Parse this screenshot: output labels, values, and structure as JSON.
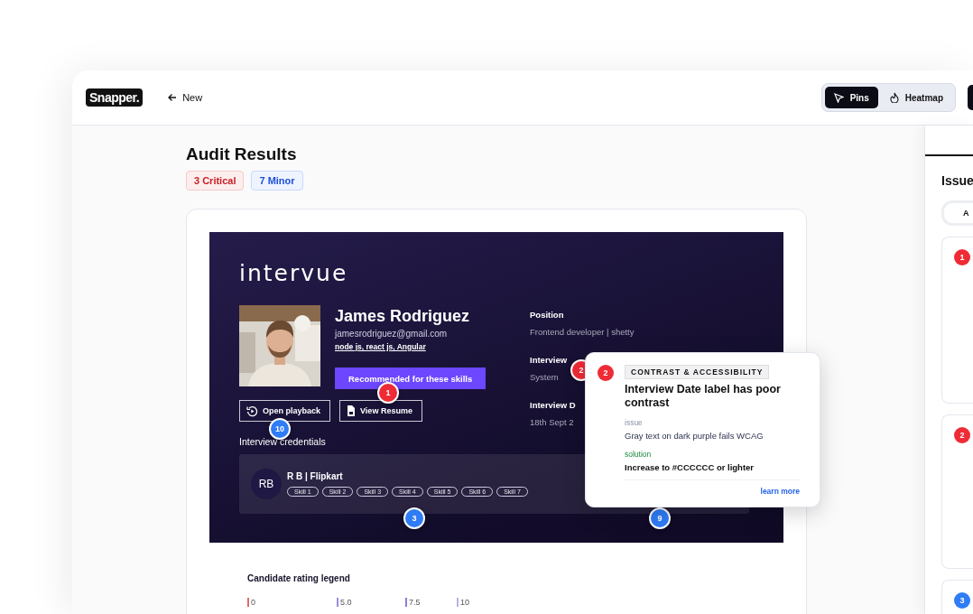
{
  "header": {
    "logo": "Snapper.",
    "back_label": "New",
    "modes": [
      {
        "label": "Pins",
        "kind": "pins",
        "selected": true
      },
      {
        "label": "Heatmap",
        "kind": "heatmap",
        "selected": false
      }
    ]
  },
  "audit": {
    "title": "Audit Results",
    "badges": [
      {
        "label": "3 Critical",
        "kind": "critical"
      },
      {
        "label": "7 Minor",
        "kind": "minor"
      }
    ]
  },
  "preview": {
    "logo": "intervue",
    "candidate": {
      "name": "James Rodriguez",
      "email": "jamesrodriguez@gmail.com",
      "skills": "node js, react js, Angular",
      "recommend_button": "Recommended for these skills",
      "actions": [
        {
          "label": "Open playback",
          "kind": "playback"
        },
        {
          "label": "View Resume",
          "kind": "resume"
        }
      ]
    },
    "fields": [
      {
        "label": "Position",
        "value": "Frontend developer | shetty"
      },
      {
        "label": "Interview",
        "value": "System"
      },
      {
        "label": "Interview D",
        "value": "18th Sept 2"
      }
    ],
    "credentials": {
      "title": "Interview credentials",
      "initials": "RB",
      "name": "R B | Flipkart",
      "tags": [
        "Skill 1",
        "Skill 2",
        "Skill 3",
        "Skill 4",
        "Skill 5",
        "Skill 6",
        "Skill 7"
      ]
    },
    "legend": {
      "title": "Candidate rating legend",
      "ticks": [
        "0",
        "5.0",
        "7.5",
        "10"
      ]
    },
    "pins": [
      {
        "label": "1",
        "color": "#ef2b36"
      },
      {
        "label": "2",
        "color": "#ef2b36"
      },
      {
        "label": "10",
        "color": "#2f7cf6"
      },
      {
        "label": "3",
        "color": "#2f7cf6"
      },
      {
        "label": "9",
        "color": "#2f7cf6"
      }
    ]
  },
  "popover": {
    "number": "2",
    "color": "#ef2b36",
    "category": "CONTRAST & ACCESSIBILITY",
    "title": "Interview Date label has poor contrast",
    "issue_label": "issue",
    "issue": "Gray text on dark purple fails WCAG",
    "solution_label": "solution",
    "solution": "Increase to #CCCCCC or lighter",
    "link": "learn more"
  },
  "side_panel": {
    "title": "Issue",
    "filter": "A",
    "cards": [
      {
        "number": "1",
        "color": "#ef2b36"
      },
      {
        "number": "2",
        "color": "#ef2b36"
      },
      {
        "number": "3",
        "color": "#2f7cf6"
      }
    ]
  }
}
